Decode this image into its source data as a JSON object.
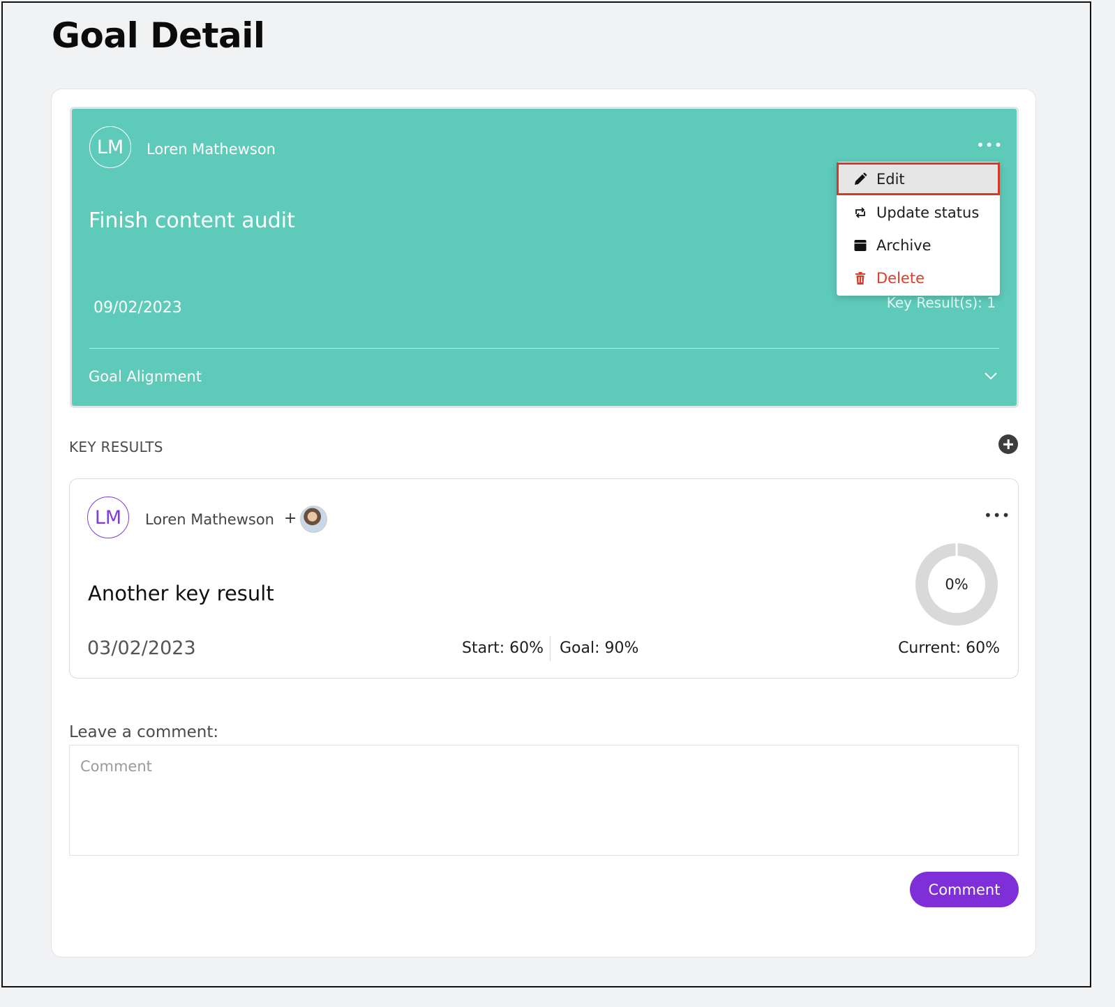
{
  "page": {
    "title": "Goal Detail"
  },
  "goal": {
    "avatar_initials": "LM",
    "owner": "Loren Mathewson",
    "more_label": "•••",
    "title": "Finish content audit",
    "date": "09/02/2023",
    "key_results_count": "Key Result(s): 1",
    "alignment_label": "Goal Alignment",
    "color": "#5ecab9"
  },
  "menu": {
    "items": [
      {
        "label": "Edit",
        "icon": "pencil-icon"
      },
      {
        "label": "Update status",
        "icon": "repeat-icon"
      },
      {
        "label": "Archive",
        "icon": "archive-icon"
      },
      {
        "label": "Delete",
        "icon": "trash-icon",
        "color": "#e03b24"
      }
    ],
    "highlighted": "Edit"
  },
  "key_results": {
    "heading": "KEY RESULTS",
    "items": [
      {
        "avatar_initials": "LM",
        "owner": "Loren Mathewson",
        "plus": "+",
        "more_label": "•••",
        "title": "Another key result",
        "date": "03/02/2023",
        "start": "Start: 60%",
        "goal": "Goal: 90%",
        "current": "Current: 60%",
        "progress_label": "0%",
        "progress": 0
      }
    ]
  },
  "comment": {
    "label": "Leave a comment:",
    "placeholder": "Comment",
    "value": "",
    "button_label": "Comment"
  },
  "colors": {
    "accent": "#7e2fd8",
    "danger": "#e03b24",
    "highlight_border": "#d23b24"
  }
}
